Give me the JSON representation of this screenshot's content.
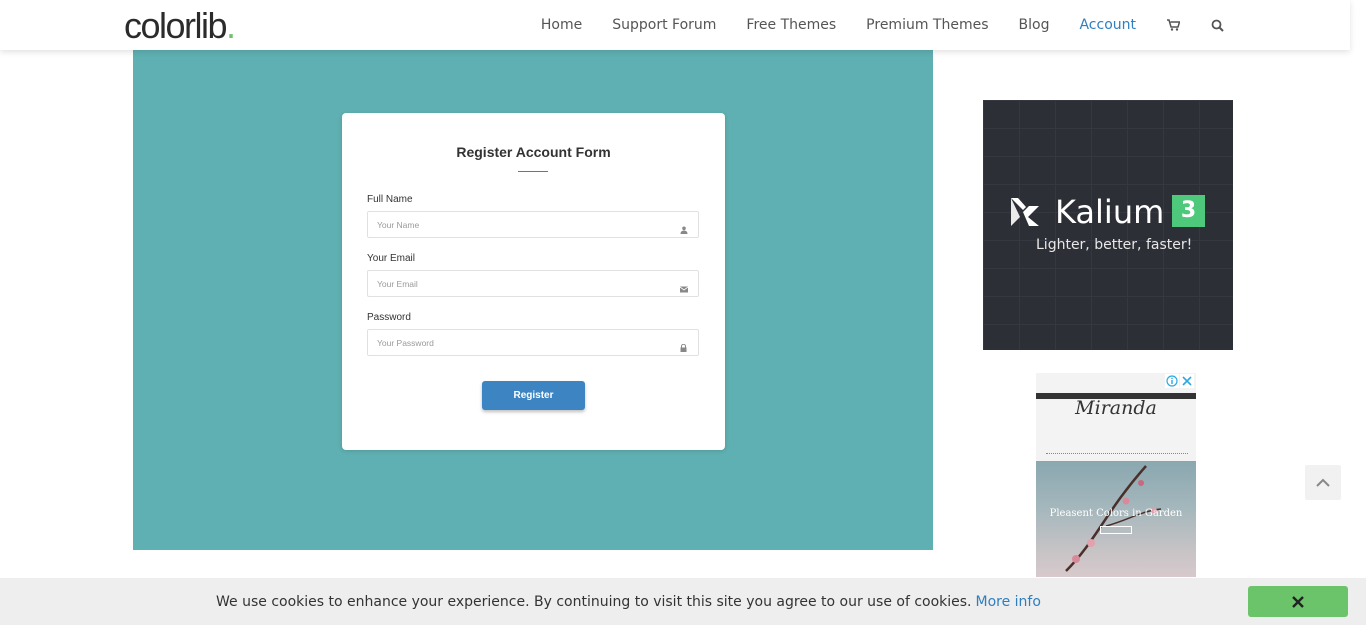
{
  "header": {
    "logo_text": "colorlib",
    "logo_dot": ".",
    "nav": [
      {
        "label": "Home"
      },
      {
        "label": "Support Forum"
      },
      {
        "label": "Free Themes"
      },
      {
        "label": "Premium Themes"
      },
      {
        "label": "Blog"
      },
      {
        "label": "Account"
      }
    ],
    "icons": [
      "cart-icon",
      "search-icon"
    ],
    "active_color": "#2f7fbf"
  },
  "form": {
    "title": "Register Account Form",
    "fields": [
      {
        "label": "Full Name",
        "placeholder": "Your Name",
        "icon": "user-icon"
      },
      {
        "label": "Your Email",
        "placeholder": "Your Email",
        "icon": "envelope-icon"
      },
      {
        "label": "Password",
        "placeholder": "Your Password",
        "icon": "lock-icon"
      }
    ],
    "submit_label": "Register",
    "bg_color": "#5fb0b2",
    "button_color": "#3d85c2"
  },
  "ads": {
    "kalium": {
      "name": "Kalium",
      "version": "3",
      "tagline": "Lighter, better, faster!"
    },
    "miranda": {
      "brand": "Miranda",
      "photo_title": "Pleasent Colors in Garden"
    }
  },
  "cookie_bar": {
    "message": "We use cookies to enhance your experience. By continuing to visit this site you agree to our use of cookies.",
    "link_label": "More info",
    "close_icon": "close-icon",
    "button_color": "#6cc46a"
  }
}
